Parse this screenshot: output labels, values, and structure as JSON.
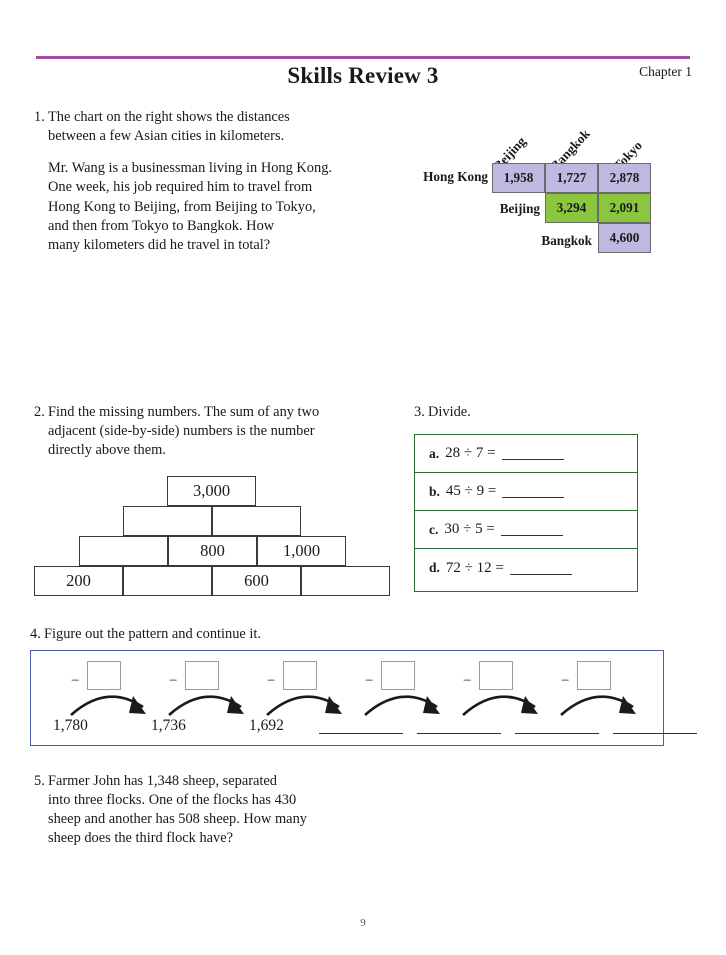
{
  "header": {
    "title": "Skills Review 3",
    "chapter": "Chapter 1"
  },
  "page_number": "9",
  "colors": {
    "rule": "#a64ca6",
    "cell_purple": "#c0b8e0",
    "cell_green": "#8cc63e",
    "divide_border": "#2d6b3d",
    "pattern_border": "#4a5fa8"
  },
  "questions": {
    "q1": {
      "number": "1.",
      "line1": "The chart on the right shows the distances",
      "line2": "between a few Asian cities in kilometers.",
      "para2_l1": "Mr. Wang is a businessman living in Hong Kong.",
      "para2_l2": "One week, his job required him to travel from",
      "para2_l3": "Hong Kong to Beijing, from Beijing to Tokyo,",
      "para2_l4": "and then from Tokyo to Bangkok. How",
      "para2_l5": "many kilometers did he travel in total?"
    },
    "q2": {
      "number": "2.",
      "line1": "Find the missing numbers. The sum of any two",
      "line2": "adjacent (side-by-side) numbers is the number",
      "line3": "directly above them."
    },
    "q3": {
      "number": "3.",
      "title": "Divide."
    },
    "q4": {
      "number": "4.",
      "title": "Figure out the pattern and continue it."
    },
    "q5": {
      "number": "5.",
      "line1": "Farmer John has 1,348 sheep, separated",
      "line2": "into three flocks. One of the flocks has 430",
      "line3": "sheep and another has 508 sheep. How many",
      "line4": "sheep does the third flock have?"
    }
  },
  "distance_chart": {
    "column_headers": [
      "Beijing",
      "Bangkok",
      "Tokyo"
    ],
    "row_labels": [
      "Hong Kong",
      "Beijing",
      "Bangkok"
    ],
    "rows": [
      {
        "label": "Hong Kong",
        "cells": [
          {
            "value": "1,958",
            "color": "purple"
          },
          {
            "value": "1,727",
            "color": "purple"
          },
          {
            "value": "2,878",
            "color": "purple"
          }
        ]
      },
      {
        "label": "Beijing",
        "cells": [
          {
            "value": "3,294",
            "color": "green"
          },
          {
            "value": "2,091",
            "color": "green"
          }
        ]
      },
      {
        "label": "Bangkok",
        "cells": [
          {
            "value": "4,600",
            "color": "purple"
          }
        ]
      }
    ]
  },
  "pyramid": {
    "rows": [
      {
        "cells": [
          "3,000"
        ]
      },
      {
        "cells": [
          "",
          ""
        ]
      },
      {
        "cells": [
          "",
          "800",
          "1,000"
        ]
      },
      {
        "cells": [
          "200",
          "",
          "600",
          ""
        ]
      }
    ]
  },
  "divide": {
    "items": [
      {
        "letter": "a.",
        "problem": "28 ÷ 7 ="
      },
      {
        "letter": "b.",
        "problem": "45 ÷ 9 ="
      },
      {
        "letter": "c.",
        "problem": "30 ÷ 5 ="
      },
      {
        "letter": "d.",
        "problem": "72 ÷ 12 ="
      }
    ]
  },
  "pattern": {
    "operator": "−",
    "step_count": 6,
    "given_values": [
      "1,780",
      "1,736",
      "1,692"
    ],
    "blank_count": 4
  }
}
